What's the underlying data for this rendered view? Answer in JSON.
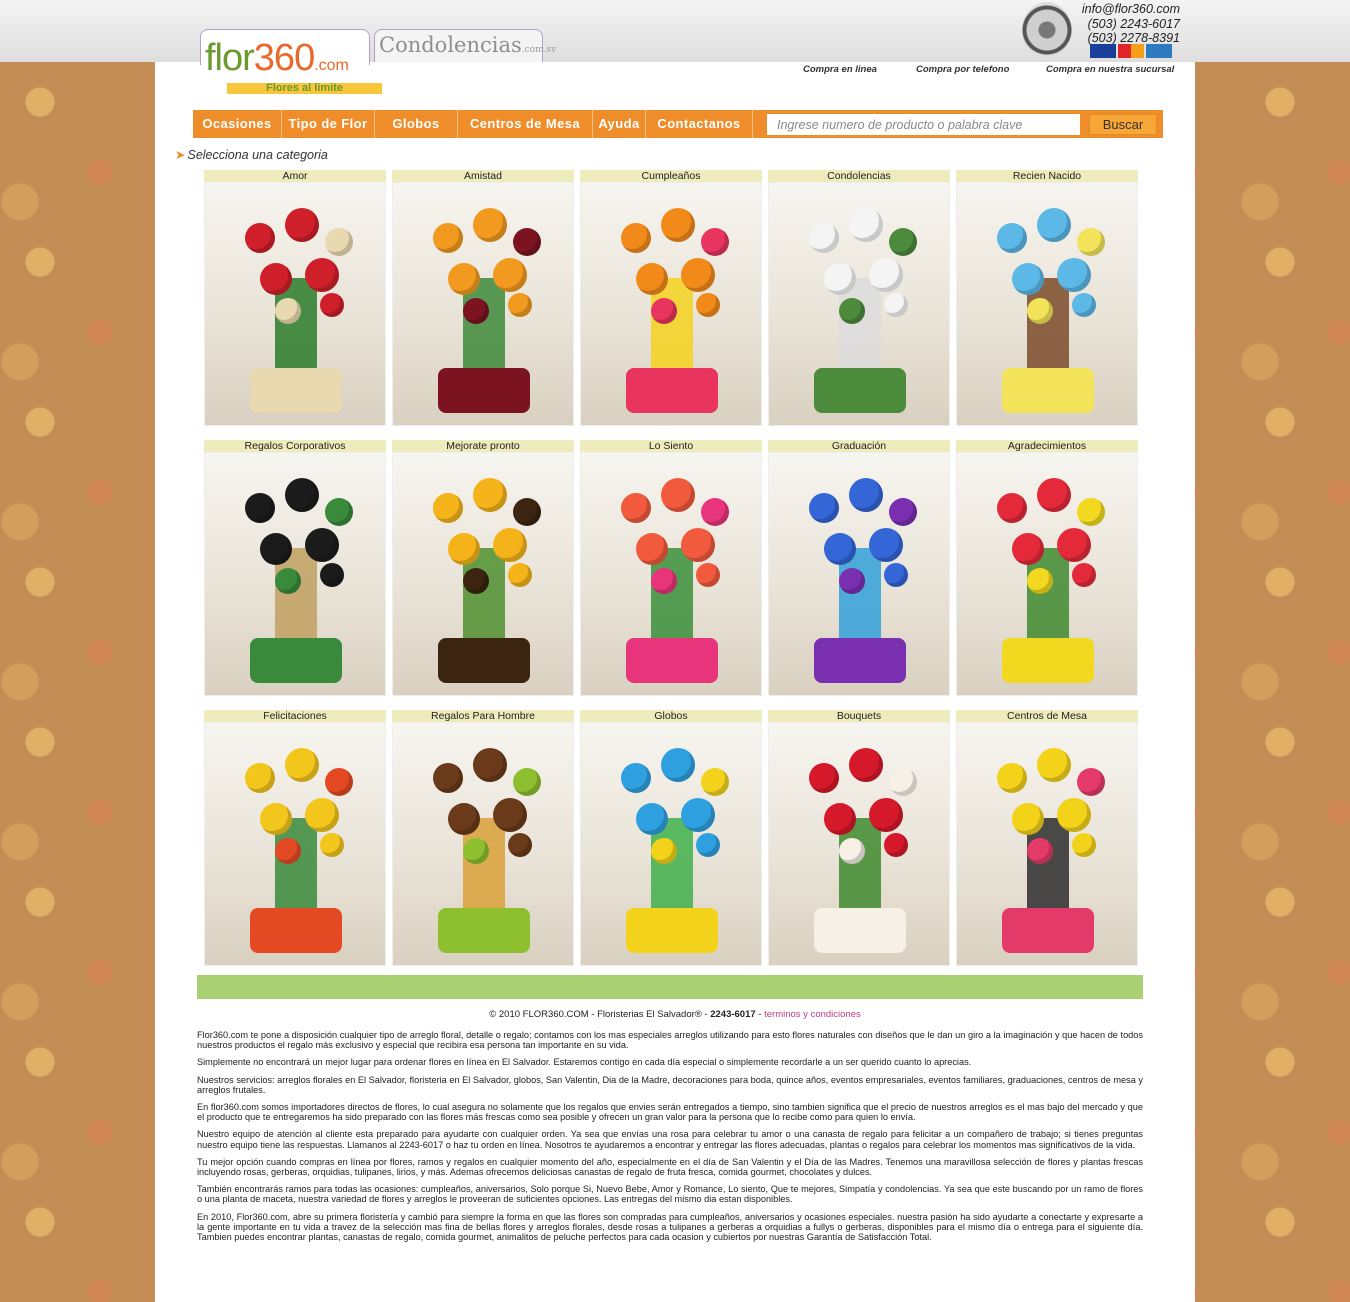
{
  "header": {
    "tabs": [
      {
        "label": "flor360.com",
        "tagline": "Flores al limite"
      },
      {
        "label": "Condolencias",
        "suffix": ".com.sv"
      }
    ],
    "contact": {
      "email": "info@flor360.com",
      "phone1": "(503) 2243-6017",
      "phone2": "(503) 2278-8391"
    },
    "cards": [
      "VISA",
      "MasterCard",
      "American Express"
    ],
    "purchase_modes": [
      "Compra en linea",
      "Compra por telefono",
      "Compra en nuestra sucursal"
    ],
    "seal": "La Gran Via"
  },
  "nav": {
    "items": [
      "Ocasiones",
      "Tipo de Flor",
      "Globos",
      "Centros de Mesa",
      "Ayuda",
      "Contactanos"
    ],
    "search_placeholder": "Ingrese numero de producto o palabra clave",
    "search_button": "Buscar"
  },
  "section_title": "Selecciona una categoria",
  "categories": [
    {
      "name": "Amor",
      "colors": [
        "#cf1f2a",
        "#e9d9b0",
        "#2b7b2b"
      ]
    },
    {
      "name": "Amistad",
      "colors": [
        "#f29a1f",
        "#7b1420",
        "#3d8a3a"
      ]
    },
    {
      "name": "Cumpleaños",
      "colors": [
        "#f28a1a",
        "#e8345f",
        "#f5d21f"
      ]
    },
    {
      "name": "Condolencias",
      "colors": [
        "#f4f4f4",
        "#4c8a3c",
        "#dcdcdc"
      ]
    },
    {
      "name": "Recien Nacido",
      "colors": [
        "#5cb8e6",
        "#f2e35a",
        "#7b4a2a"
      ]
    },
    {
      "name": "Regalos Corporativos",
      "colors": [
        "#1b1b1b",
        "#3a8a3c",
        "#c0a060"
      ]
    },
    {
      "name": "Mejorate pronto",
      "colors": [
        "#f5b31a",
        "#3b2510",
        "#4f8f2f"
      ]
    },
    {
      "name": "Lo Siento",
      "colors": [
        "#f15a3d",
        "#e8347a",
        "#3a8f3a"
      ]
    },
    {
      "name": "Graduación",
      "colors": [
        "#3466d8",
        "#7a2fb0",
        "#32a0d8"
      ]
    },
    {
      "name": "Agradecimientos",
      "colors": [
        "#e42a3a",
        "#f2d81e",
        "#3f8a2f"
      ]
    },
    {
      "name": "Felicitaciones",
      "colors": [
        "#f3c61c",
        "#e34a24",
        "#3a8a3c"
      ]
    },
    {
      "name": "Regalos Para Hombre",
      "colors": [
        "#6b3a1a",
        "#8dbf2f",
        "#d9a038"
      ]
    },
    {
      "name": "Globos",
      "colors": [
        "#2ea0e0",
        "#f2d21a",
        "#3fb04a"
      ]
    },
    {
      "name": "Bouquets",
      "colors": [
        "#d6192a",
        "#f6f0e6",
        "#3e8a2e"
      ]
    },
    {
      "name": "Centros de Mesa",
      "colors": [
        "#f3d21a",
        "#e43a6a",
        "#2d2d2d"
      ]
    }
  ],
  "footer": {
    "copyright": "© 2010 FLOR360.COM - Floristerias El Salvador® - ",
    "phone": "2243-6017",
    "separator": " - ",
    "terms": "terminos y condiciones",
    "paragraphs": [
      "Flor360.com te pone a disposición cualquier tipo de arreglo floral, detalle o regalo; contamos con los mas especiales arreglos utilizando para esto flores  naturales con diseños que le dan un giro a la imaginación y que hacen de todos nuestros productos el regalo más exclusivo y especial que recibira esa persona tan importante en su vida.",
      "Simplemente no encontrará un mejor lugar para ordenar flores en línea en El Salvador. Estaremos contigo en cada día especial o simplemente recordarle a un ser querido cuanto lo aprecias.",
      "Nuestros servicios: arreglos florales en El Salvador, floristeria en El Salvador, globos, San Valentin, Dia de la Madre, decoraciones para boda, quince años, eventos empresariales, eventos familiares, graduaciones, centros de mesa y arreglos frutales.",
      "En flor360.com somos importadores directos de flores, lo cual asegura no solamente  que los regalos que envies serán entregados a tiempo, sino tambien significa que el precio de nuestros arreglos es el mas bajo del mercado y que el producto que te entregaremos ha sido preparado con las flores más frescas como sea posible  y ofrecen un gran valor para la persona que lo recibe como para quien lo envía.",
      "Nuestro equipo de atención al cliente esta preparado para ayudarte con cualquier orden. Ya sea que envías una  rosa para celebrar tu amor o una canasta de regalo para felicitar a un compañero de trabajo; si tienes preguntas nuestro equipo tiene las respuestas. Llamanos al 2243-6017 o haz tu orden en línea. Nosotros te ayudaremos a encontrar y entregar las flores adecuadas, plantas o regalos para celebrar los momentos mas significativos de la vida.",
      "Tu mejor opción cuando compras en línea por flores, ramos y regalos en cualquier momento del año, especialmente en el día de San Valentin y el Día de las Madres. Tenemos una maravillosa selección de flores y plantas frescas incluyendo rosas, gerberas, orquidias, tulipanes, lirios, y más. Ademas ofrecemos deliciosas canastas de regalo de fruta fresca, comida gourmet, chocolates y dulces.",
      "También encontrarás ramos para todas las ocasiones: cumpleaños, aniversarios, Solo porque Si, Nuevo Bebe, Amor y Romance, Lo siento, Que te mejores, Simpatía y condolencias.  Ya sea que este buscando por un ramo de flores o una planta de maceta, nuestra variedad de flores y arreglos le proveeran de suficientes opciones. Las entregas del mismo dia estan disponibles.",
      "En 2010, Flor360.com, abre su primera floristería y cambió para siempre la forma en que las flores son compradas para cumpleaños, aniversarios y ocasiones especiales. nuestra pasión ha sido ayudarte a conectarte y expresarte a la gente importante en tu vida a travez de la selección mas fina de bellas flores y arreglos florales, desde rosas a tulipanes a gerberas a orquidias a fullys o gerberas, disponibles para el mismo día o entrega para el siguiente día. Tambien puedes encontrar plantas, canastas de regalo, comida gourmet, animalitos de peluche perfectos para cada ocasion y cubiertos por nuestras Garantía de Satisfacción Total."
    ]
  }
}
